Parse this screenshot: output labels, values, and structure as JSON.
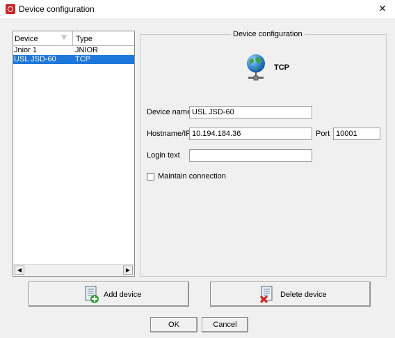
{
  "window": {
    "title": "Device configuration",
    "close_glyph": "✕"
  },
  "device_list": {
    "columns": [
      "Device",
      "Type"
    ],
    "rows": [
      {
        "device": "Jnior 1",
        "type": "JNIOR"
      },
      {
        "device": "USL JSD-60",
        "type": "TCP"
      }
    ],
    "selected_index": 1
  },
  "config_panel": {
    "title": "Device configuration",
    "protocol": "TCP",
    "icon": "network-globe-icon",
    "device_name": {
      "label": "Device name",
      "value": "USL JSD-60"
    },
    "hostname": {
      "label": "Hostname/IP",
      "value": "10.194.184.36"
    },
    "port": {
      "label": "Port",
      "value": "10001"
    },
    "login_text": {
      "label": "Login text",
      "value": ""
    },
    "maintain_connection": {
      "label": "Maintain connection",
      "checked": false
    }
  },
  "buttons": {
    "add_device": "Add device",
    "delete_device": "Delete device",
    "ok": "OK",
    "cancel": "Cancel"
  },
  "colors": {
    "selection": "#1e78dc",
    "background": "#f0f0f0"
  }
}
